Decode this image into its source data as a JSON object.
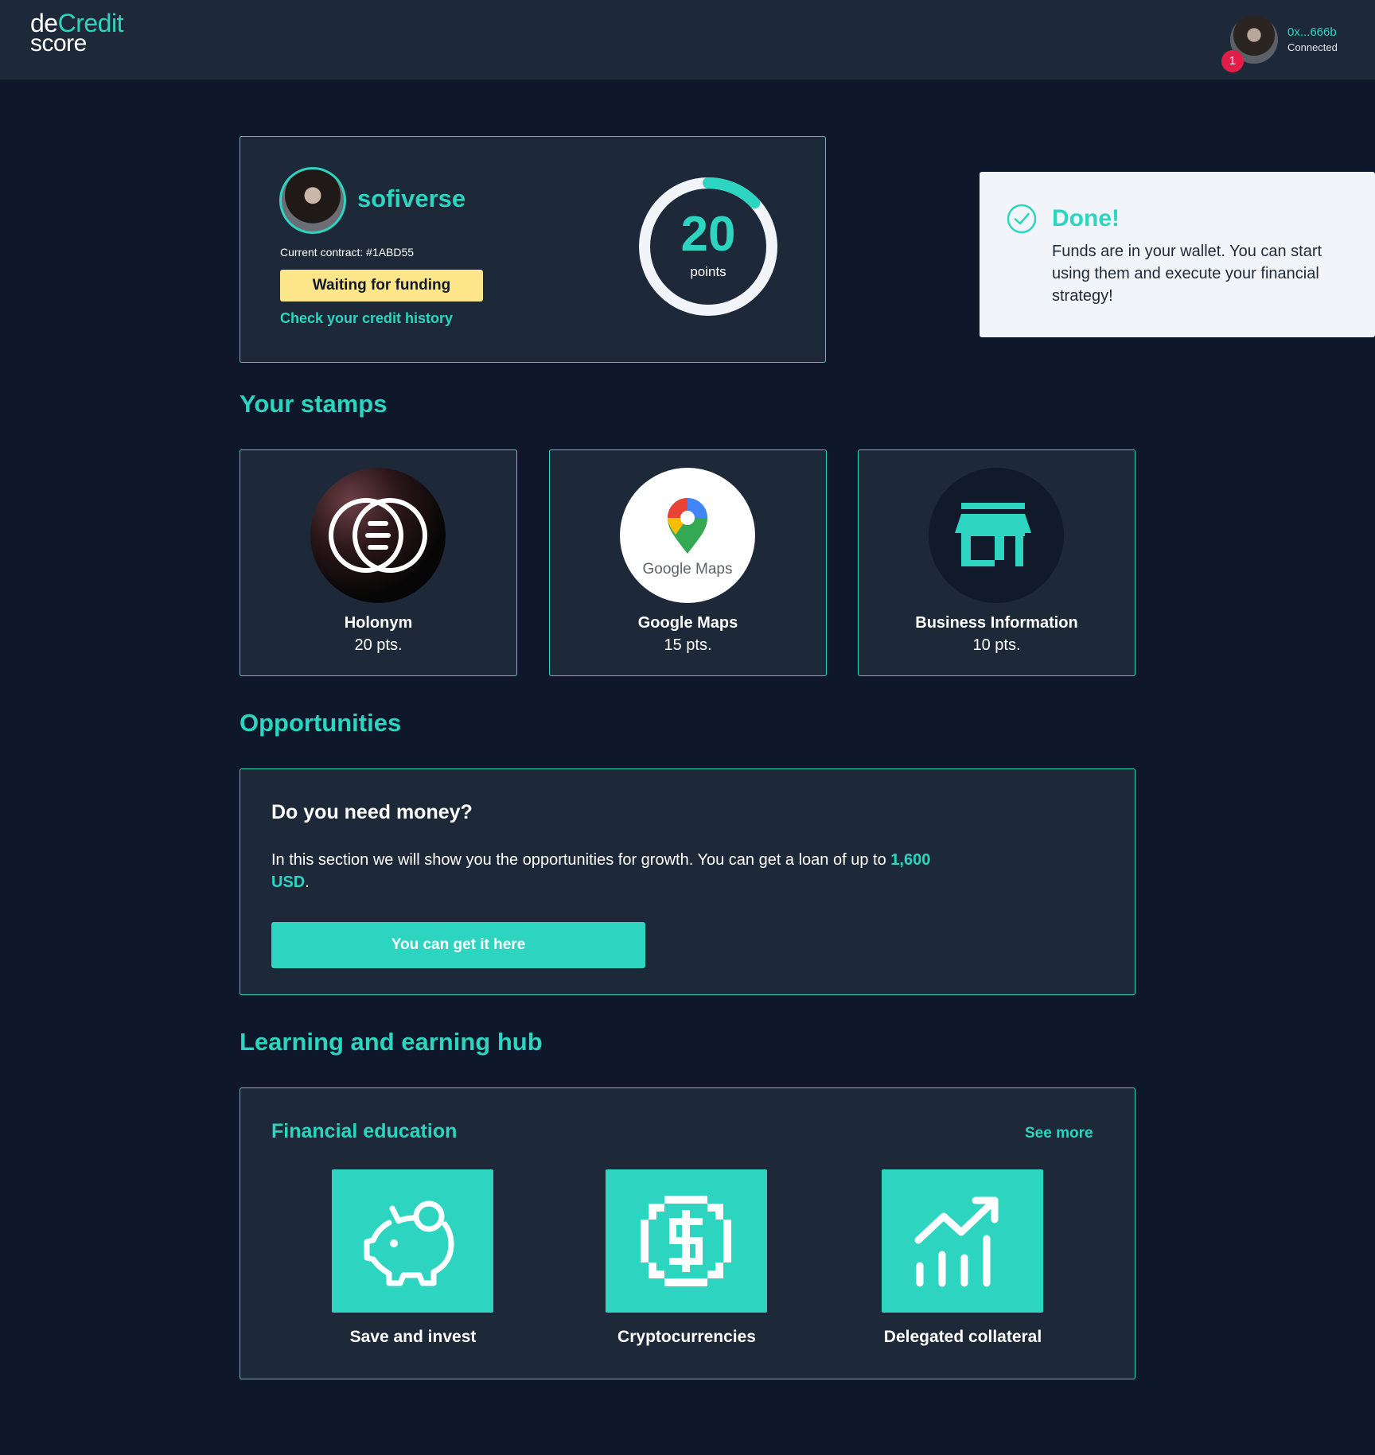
{
  "header": {
    "logo": {
      "de": "de",
      "credit": "Credit",
      "score": "score"
    },
    "wallet": {
      "address": "0x...666b",
      "status": "Connected"
    },
    "notification_count": "1"
  },
  "profile": {
    "name": "sofiverse",
    "contract": "Current contract: #1ABD55",
    "status": "Waiting for funding",
    "history_link": "Check your credit history",
    "score": {
      "value": "20",
      "unit": "points",
      "progress_fraction": 0.13
    }
  },
  "toast": {
    "title": "Done!",
    "message": "Funds are in your wallet. You can start using them and execute your financial strategy!"
  },
  "stamps": {
    "title": "Your stamps",
    "items": [
      {
        "name": "Holonym",
        "points": "20 pts."
      },
      {
        "name": "Google Maps",
        "points": "15 pts.",
        "logo_text": "Google Maps"
      },
      {
        "name": "Business Information",
        "points": "10 pts."
      }
    ]
  },
  "opportunities": {
    "title": "Opportunities",
    "card_title": "Do you need money?",
    "text_before": "In this section we will show you the opportunities for growth. You can get a loan of up to ",
    "amount": "1,600 USD",
    "text_after": ".",
    "button_label": "You can get it here"
  },
  "hub": {
    "title": "Learning and earning hub",
    "card_title": "Financial education",
    "see_more": "See more",
    "items": [
      {
        "label": "Save and invest",
        "icon": "piggy-bank-icon"
      },
      {
        "label": "Cryptocurrencies",
        "icon": "dollar-coin-icon"
      },
      {
        "label": "Delegated collateral",
        "icon": "growth-chart-icon"
      }
    ]
  },
  "colors": {
    "accent": "#2dd4bf",
    "background": "#0f172a",
    "card": "#1d2939",
    "pending": "#fde68a",
    "alert": "#e11d48"
  }
}
